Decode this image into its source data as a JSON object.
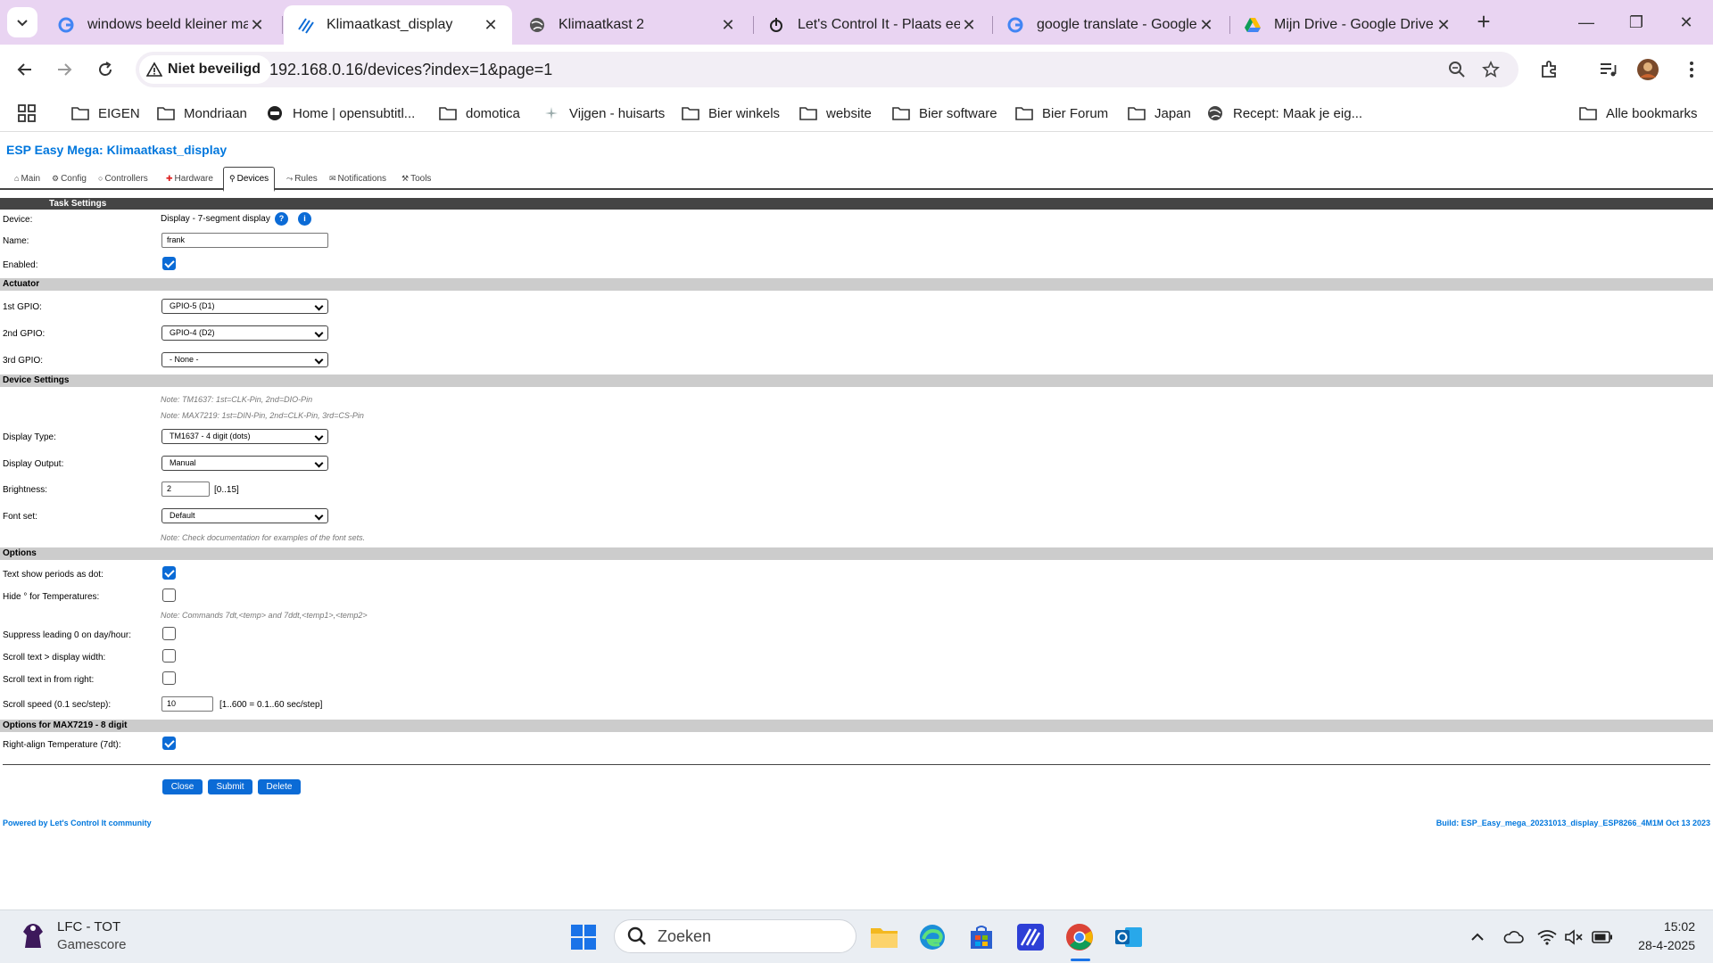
{
  "browser": {
    "tabs": [
      {
        "title": "windows beeld kleiner mak",
        "icon": "google-icon"
      },
      {
        "title": "Klimaatkast_display",
        "icon": "espeasy-icon",
        "active": true
      },
      {
        "title": "Klimaatkast 2",
        "icon": "globe-icon"
      },
      {
        "title": "Let's Control It - Plaats een",
        "icon": "letscontrolit-icon"
      },
      {
        "title": "google translate - Google",
        "icon": "google-icon"
      },
      {
        "title": "Mijn Drive - Google Drive",
        "icon": "google-drive-icon"
      }
    ],
    "security_label": "Niet beveiligd",
    "url": "192.168.0.16/devices?index=1&page=1",
    "bookmarks": [
      "EIGEN",
      "Mondriaan",
      "Home | opensubtitl...",
      "domotica",
      "Vijgen - huisarts",
      "Bier winkels",
      "website",
      "Bier software",
      "Bier Forum",
      "Japan",
      "Recept: Maak je eig..."
    ],
    "all_bookmarks": "Alle bookmarks"
  },
  "esp": {
    "title": "ESP Easy Mega: Klimaatkast_display",
    "menu": [
      "Main",
      "Config",
      "Controllers",
      "Hardware",
      "Devices",
      "Rules",
      "Notifications",
      "Tools"
    ],
    "task_settings": "Task Settings",
    "device_label": "Device:",
    "device_value": "Display - 7-segment display",
    "help_q": "?",
    "help_i": "i",
    "name_label": "Name:",
    "name_value": "frank",
    "enabled_label": "Enabled:",
    "actuator": "Actuator",
    "gpio1_label": "1st GPIO:",
    "gpio1_value": "GPIO-5 (D1)",
    "gpio2_label": "2nd GPIO:",
    "gpio2_value": "GPIO-4 (D2)",
    "gpio3_label": "3rd GPIO:",
    "gpio3_value": "- None -",
    "device_settings": "Device Settings",
    "note_tm1637": "Note: TM1637: 1st=CLK-Pin, 2nd=DIO-Pin",
    "note_max7219": "Note: MAX7219: 1st=DIN-Pin, 2nd=CLK-Pin, 3rd=CS-Pin",
    "display_type_label": "Display Type:",
    "display_type_value": "TM1637 - 4 digit (dots)",
    "display_output_label": "Display Output:",
    "display_output_value": "Manual",
    "brightness_label": "Brightness:",
    "brightness_value": "2",
    "brightness_range": "[0..15]",
    "font_set_label": "Font set:",
    "font_set_value": "Default",
    "note_fontset": "Note: Check documentation for examples of the font sets.",
    "options": "Options",
    "periods_label": "Text show periods as dot:",
    "hide_deg_label": "Hide ° for Temperatures:",
    "note_commands": "Note: Commands 7dt,<temp> and 7ddt,<temp1>,<temp2>",
    "suppress_label": "Suppress leading 0 on day/hour:",
    "scroll_width_label": "Scroll text > display width:",
    "scroll_right_label": "Scroll text in from right:",
    "scroll_speed_label": "Scroll speed (0.1 sec/step):",
    "scroll_speed_value": "10",
    "scroll_speed_range": "[1..600 = 0.1..60 sec/step]",
    "options_max": "Options for MAX7219 - 8 digit",
    "right_align_label": "Right-align Temperature (7dt):",
    "btn_close": "Close",
    "btn_submit": "Submit",
    "btn_delete": "Delete",
    "powered": "Powered by Let's Control It community",
    "build": "Build: ESP_Easy_mega_20231013_display_ESP8266_4M1M Oct 13 2023"
  },
  "taskbar": {
    "widget_title": "LFC - TOT",
    "widget_sub": "Gamescore",
    "search_placeholder": "Zoeken",
    "time": "15:02",
    "date": "28-4-2025"
  },
  "colors": {
    "accent": "#0b6bd6",
    "esp_blue": "#0077dd",
    "tab_strip": "#e9d4f2"
  }
}
